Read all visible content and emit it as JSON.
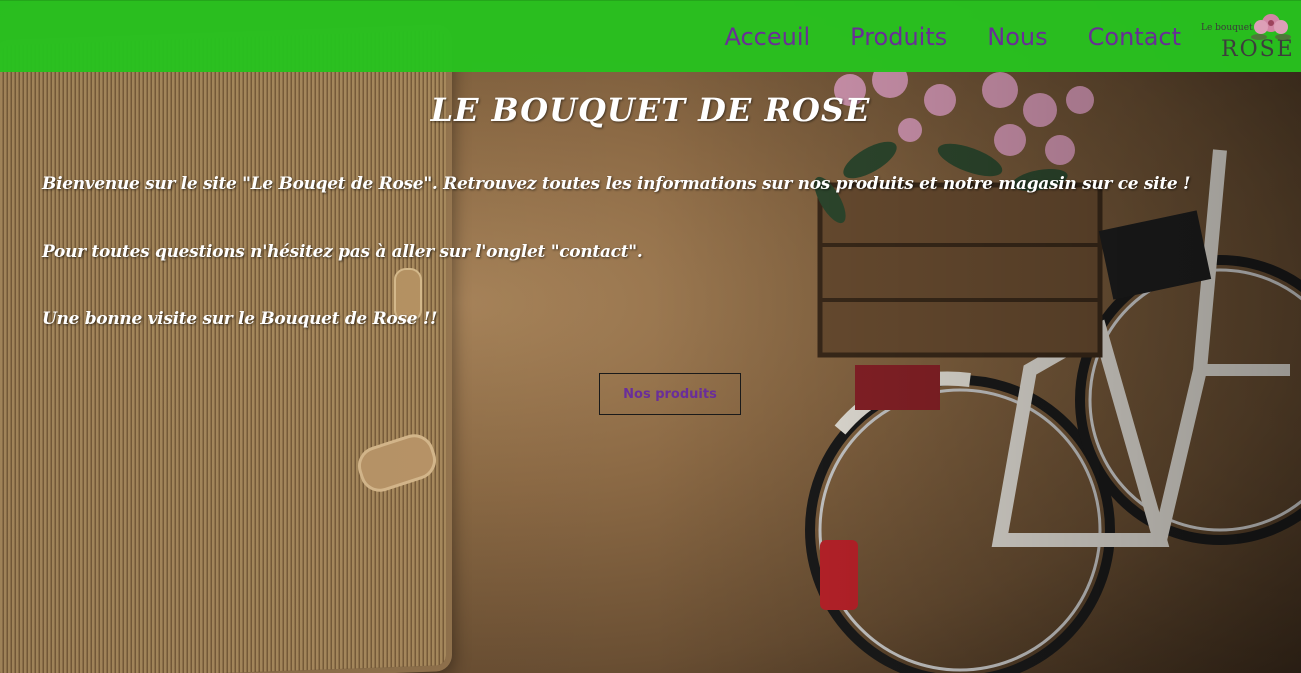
{
  "header": {
    "nav": [
      {
        "label": "Acceuil"
      },
      {
        "label": "Produits"
      },
      {
        "label": "Nous"
      },
      {
        "label": "Contact"
      }
    ],
    "logo": {
      "small_text": "Le bouquet de",
      "big_text": "ROSE"
    }
  },
  "main": {
    "title": "LE BOUQUET DE ROSE",
    "paragraphs": [
      "Bienvenue sur le site \"Le Bouqet de Rose\". Retrouvez toutes les informations sur nos produits et notre magasin sur ce site !",
      "Pour toutes questions n'hésitez pas à aller sur l'onglet \"contact\".",
      "Une bonne visite sur le Bouquet de Rose !!"
    ],
    "cta_label": "Nos produits"
  },
  "colors": {
    "header_bg": "#28c21f",
    "nav_text": "#6a2e9a",
    "heading_text": "#ffffff"
  }
}
